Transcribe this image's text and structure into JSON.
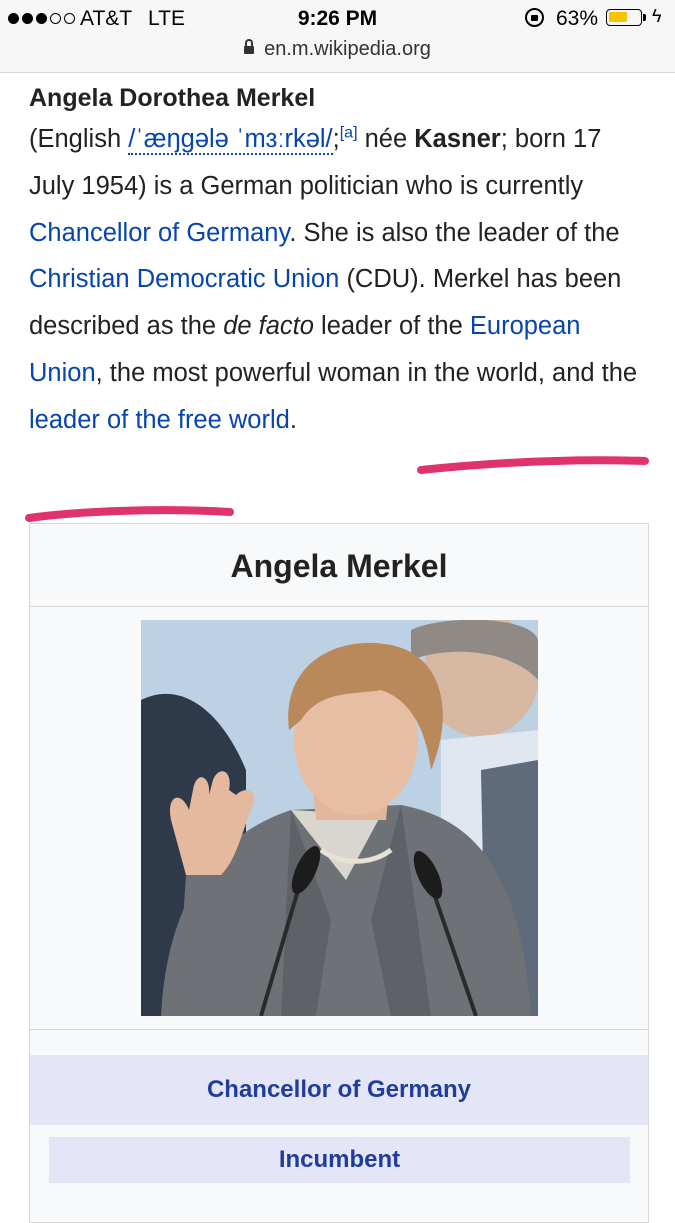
{
  "status_bar": {
    "carrier": "AT&T",
    "network": "LTE",
    "time": "9:26 PM",
    "battery_percent": "63%",
    "battery_level": 0.63,
    "signal_bars_filled": 3,
    "signal_bars_total": 5,
    "icons": [
      "signal-dots-icon",
      "orientation-lock-icon",
      "battery-icon",
      "charging-bolt-icon"
    ]
  },
  "browser": {
    "url": "en.m.wikipedia.org",
    "lock_icon": "padlock-icon"
  },
  "article": {
    "name_bold": "Angela Dorothea Merkel",
    "p_open": "(English ",
    "ipa": "/ˈæŋɡələ ˈmɜːrkəl/",
    "p_after_ipa": ";",
    "ref": "[a]",
    "p_nee": " née ",
    "birth_name": "Kasner",
    "p_born": "; born 17 July 1954) is a German politician who is currently ",
    "link_chancellor": "Chancellor of Germany",
    "p_leader": ". She is also the leader of the ",
    "link_cdu": "Christian Democratic Union",
    "p_cdu": " (CDU). Merkel has been described as the ",
    "italic_de": "de facto",
    "p_defacto": " leader of the ",
    "link_eu": "European Union",
    "p_powerful": ", the most powerful woman in the world, and the ",
    "link_free_world": "leader of the free world",
    "p_end": "."
  },
  "infobox": {
    "title": "Angela Merkel",
    "photo_alt": "Angela Merkel",
    "office": "Chancellor of Germany",
    "status": "Incumbent"
  },
  "colors": {
    "link": "#0645ad",
    "infobox_header": "#e5e5f8",
    "infobox_header_text": "#1f3d99",
    "marker": "#e0336b",
    "battery": "#f7c500"
  }
}
